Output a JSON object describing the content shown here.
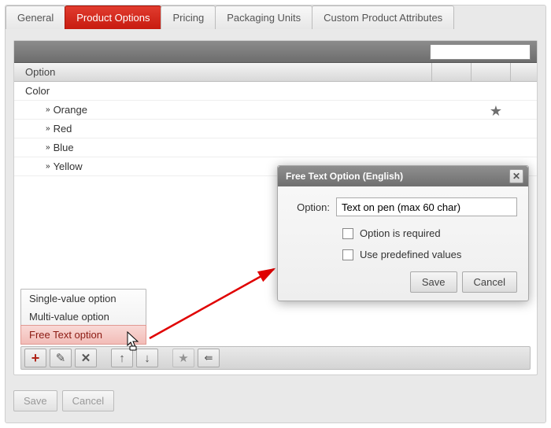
{
  "tabs": {
    "general": "General",
    "product_options": "Product Options",
    "pricing": "Pricing",
    "packaging_units": "Packaging Units",
    "custom_attrs": "Custom Product Attributes"
  },
  "table": {
    "header": "Option",
    "parent": "Color",
    "children": [
      "Orange",
      "Red",
      "Blue",
      "Yellow"
    ]
  },
  "context_menu": {
    "item0": "Single-value option",
    "item1": "Multi-value option",
    "item2": "Free Text option"
  },
  "dialog": {
    "title": "Free Text Option (English)",
    "field_label": "Option:",
    "field_value": "Text on pen (max 60 char)",
    "chk_required": "Option is required",
    "chk_predef": "Use predefined values",
    "save": "Save",
    "cancel": "Cancel"
  },
  "bottom": {
    "save": "Save",
    "cancel": "Cancel"
  }
}
